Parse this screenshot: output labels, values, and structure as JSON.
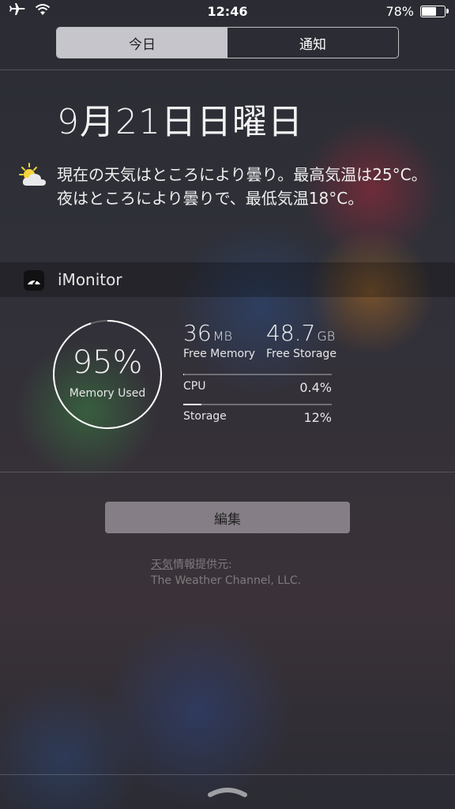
{
  "status_bar": {
    "time": "12:46",
    "battery_percent": "78%",
    "battery_level": 0.78,
    "icons": [
      "airplane-icon",
      "wifi-icon",
      "battery-icon"
    ]
  },
  "tabs": [
    {
      "label": "今日",
      "active": true
    },
    {
      "label": "通知",
      "active": false
    }
  ],
  "date": "9月21日日曜日",
  "weather": {
    "icon": "partly-cloudy-icon",
    "text": "現在の天気はところにより曇り。最高気温は25°C。夜はところにより曇りで、最低気温18°C。"
  },
  "imonitor": {
    "title": "iMonitor",
    "memory_used_pct": "95%",
    "memory_used_label": "Memory Used",
    "memory_used_value": 0.95,
    "free_memory": {
      "value": "36",
      "unit": "MB",
      "label": "Free Memory"
    },
    "free_storage": {
      "value": "48.7",
      "unit": "GB",
      "label": "Free Storage"
    },
    "cpu": {
      "label": "CPU",
      "value": "0.4%",
      "fraction": 0.004
    },
    "storage": {
      "label": "Storage",
      "value": "12%",
      "fraction": 0.12
    }
  },
  "edit_button": "編集",
  "credit": {
    "link": "天気",
    "line1_rest": "情報提供元:",
    "line2": "The Weather Channel, LLC."
  },
  "colors": {
    "accent": "#ffffff",
    "segment_active": "#e1e1e6"
  }
}
